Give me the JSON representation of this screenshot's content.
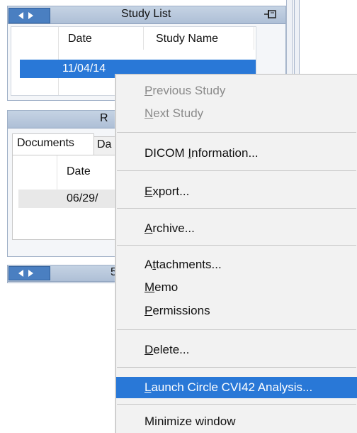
{
  "study_list": {
    "title": "Study List",
    "columns": [
      "Date",
      "Study Name"
    ],
    "selected_row_date": "11/04/14"
  },
  "reports_panel": {
    "title_visible": "R",
    "tab_documents": "Documents",
    "tab_other_visible": "Da",
    "column_date": "Date",
    "row_date_visible": "06/29/"
  },
  "bottom_panel": {
    "visible_text": "5"
  },
  "context_menu": {
    "items": [
      {
        "pre": "",
        "u": "P",
        "post": "revious Study",
        "disabled": true
      },
      {
        "pre": "",
        "u": "N",
        "post": "ext Study",
        "disabled": true
      },
      {
        "pre": "DICOM ",
        "u": "I",
        "post": "nformation...",
        "disabled": false
      },
      {
        "pre": "",
        "u": "E",
        "post": "xport...",
        "disabled": false
      },
      {
        "pre": "",
        "u": "A",
        "post": "rchive...",
        "disabled": false
      },
      {
        "pre": "A",
        "u": "t",
        "post": "tachments...",
        "disabled": false
      },
      {
        "pre": "",
        "u": "M",
        "post": "emo",
        "disabled": false
      },
      {
        "pre": "",
        "u": "P",
        "post": "ermissions",
        "disabled": false
      },
      {
        "pre": "",
        "u": "D",
        "post": "elete...",
        "disabled": false
      },
      {
        "pre": "",
        "u": "L",
        "post": "aunch Circle CVI42 Analysis...",
        "disabled": false
      },
      {
        "pre": "Minimize window",
        "u": "",
        "post": "",
        "disabled": false
      }
    ]
  },
  "colors": {
    "header": "#b6c6dc",
    "selection": "#2978d7",
    "nav_button": "#4a7fc1"
  }
}
